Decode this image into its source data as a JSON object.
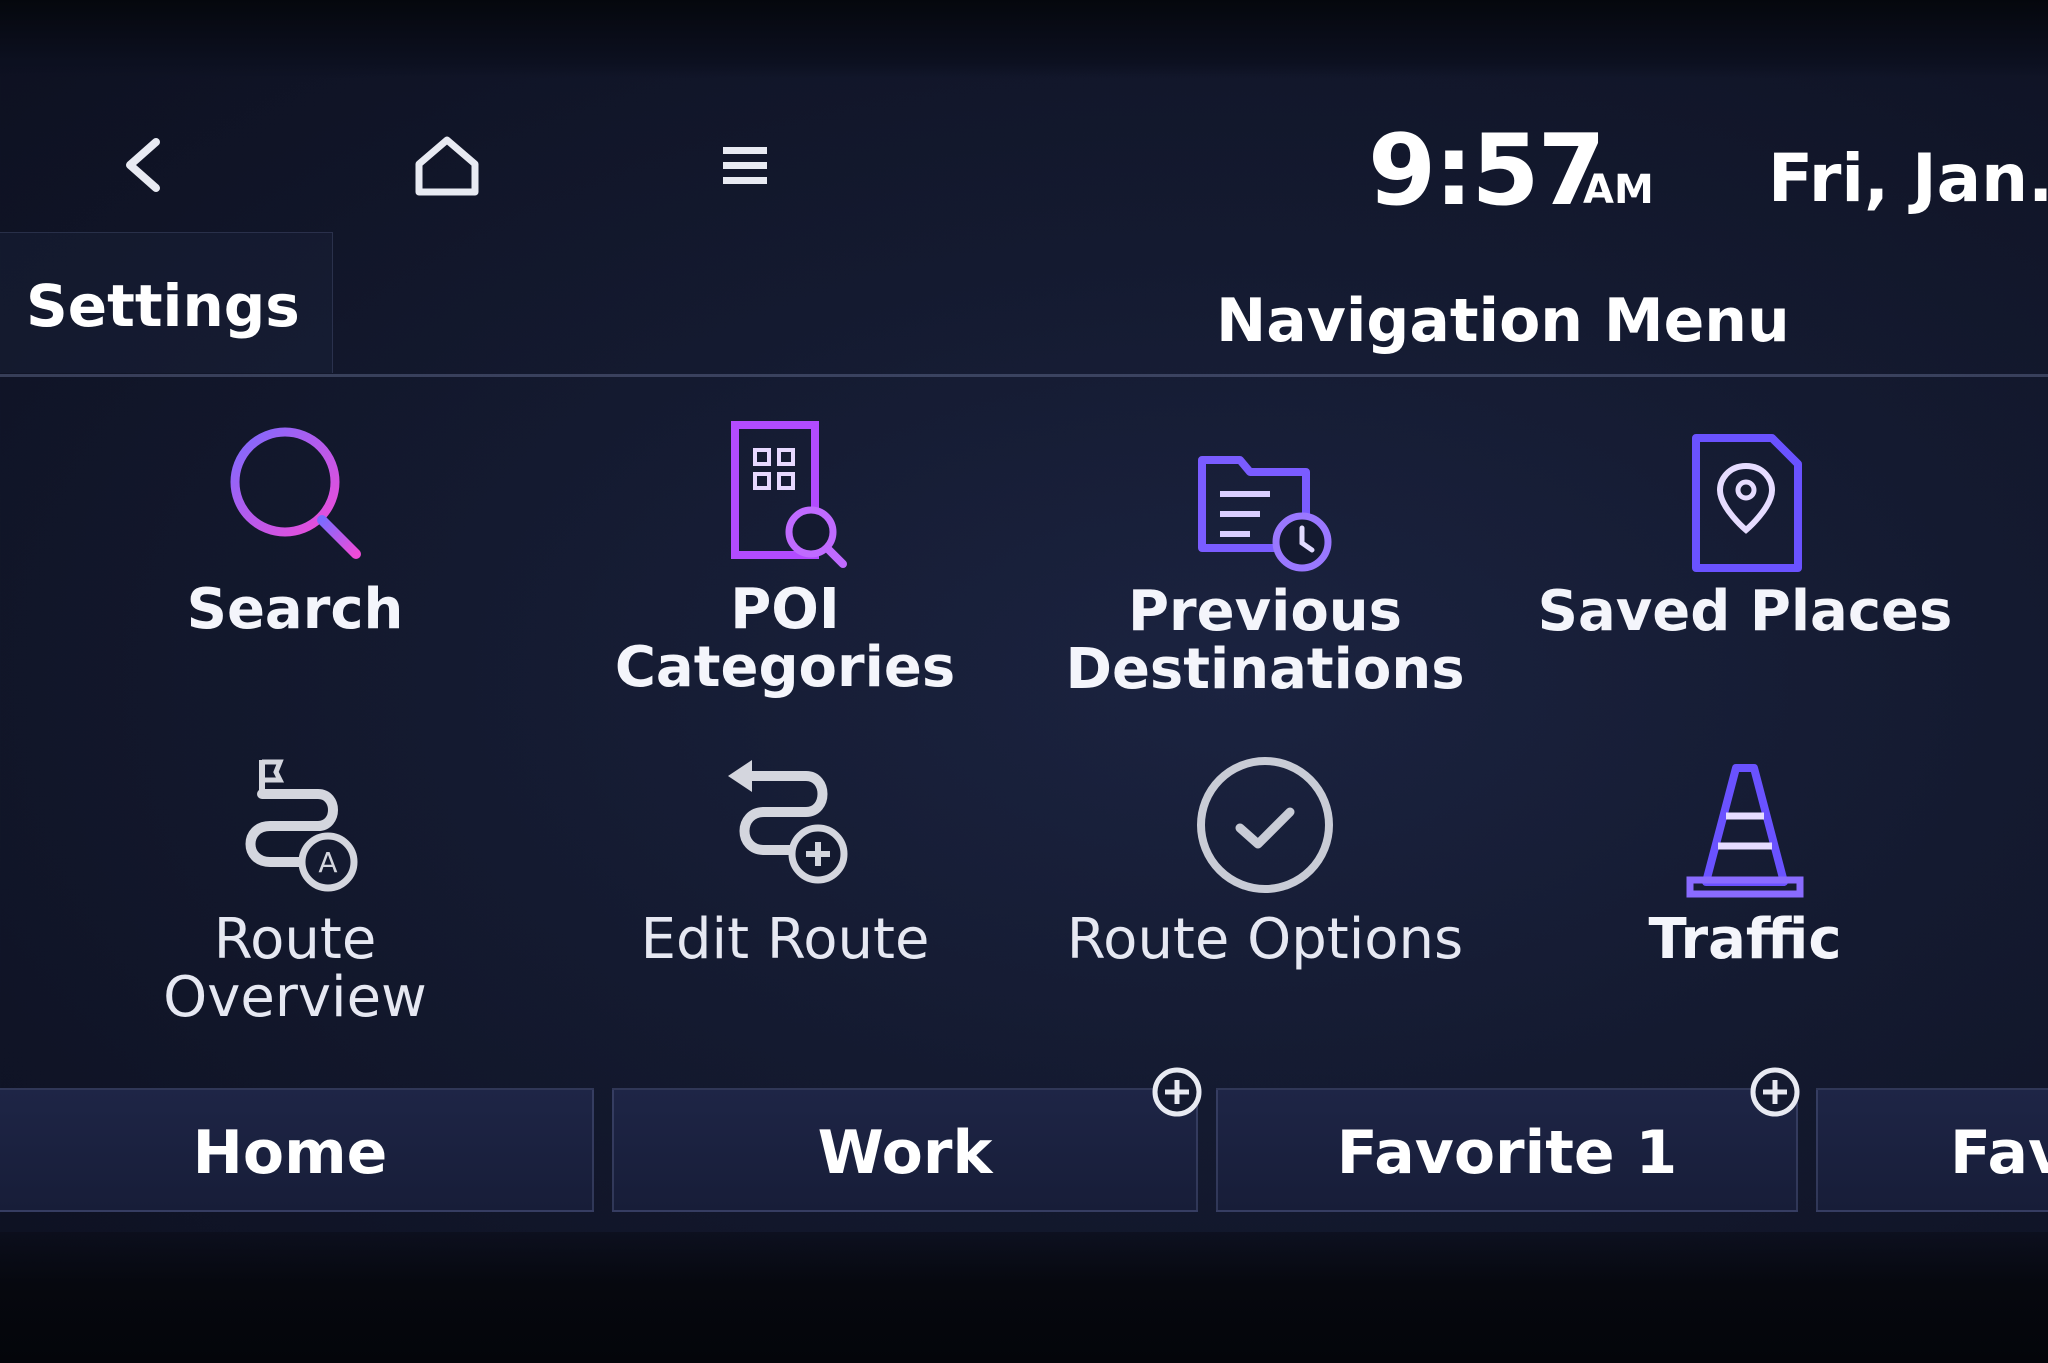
{
  "status_bar": {
    "back_icon": "chevron-left-icon",
    "home_icon": "home-icon",
    "menu_icon": "hamburger-menu-icon",
    "time": "9:57",
    "ampm": "AM",
    "date": "Fri, Jan."
  },
  "header": {
    "settings_label": "Settings",
    "title": "Navigation Menu"
  },
  "menu": {
    "items": [
      {
        "label": "Search",
        "icon": "search-icon"
      },
      {
        "label_line1": "POI",
        "label_line2": "Categories",
        "icon": "poi-categories-icon"
      },
      {
        "label_line1": "Previous",
        "label_line2": "Destinations",
        "icon": "previous-destinations-icon"
      },
      {
        "label": "Saved Places",
        "icon": "saved-places-icon"
      },
      {
        "label_line1": "Route",
        "label_line2": "Overview",
        "icon": "route-overview-icon"
      },
      {
        "label": "Edit Route",
        "icon": "edit-route-icon"
      },
      {
        "label": "Route Options",
        "icon": "route-options-icon"
      },
      {
        "label": "Traffic",
        "icon": "traffic-cone-icon"
      }
    ]
  },
  "quick_bar": {
    "items": [
      {
        "label": "Home"
      },
      {
        "label": "Work"
      },
      {
        "label": "Favorite 1"
      },
      {
        "label": "Fav"
      }
    ]
  },
  "colors": {
    "background": "#141a30",
    "icon_purple": "#8b5cff",
    "icon_magenta": "#e040fb",
    "icon_grey": "#c9ccd6"
  }
}
